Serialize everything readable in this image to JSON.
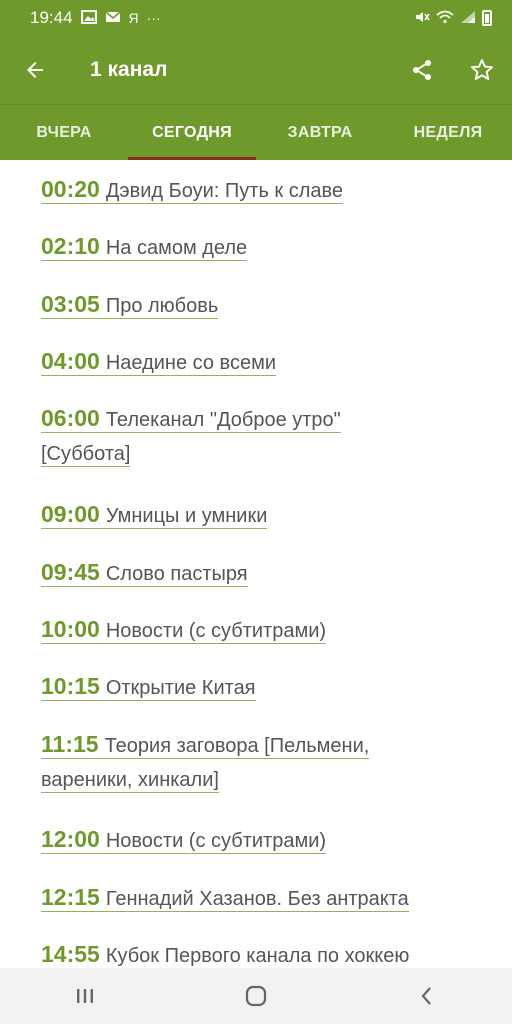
{
  "status": {
    "time": "19:44",
    "carrier_glyph": "Я",
    "more": "···"
  },
  "appbar": {
    "title": "1 канал"
  },
  "tabs": [
    "ВЧЕРА",
    "СЕГОДНЯ",
    "ЗАВТРА",
    "НЕДЕЛЯ"
  ],
  "active_tab": "СЕГОДНЯ",
  "schedule": [
    {
      "time": "00:20",
      "title": "Дэвид Боуи: Путь к славе"
    },
    {
      "time": "02:10",
      "title": "На самом деле"
    },
    {
      "time": "03:05",
      "title": "Про любовь"
    },
    {
      "time": "04:00",
      "title": "Наедине со всеми"
    },
    {
      "time": "06:00",
      "title": "Телеканал \"Доброе утро\" [Суббота]"
    },
    {
      "time": "09:00",
      "title": "Умницы и умники"
    },
    {
      "time": "09:45",
      "title": "Слово пастыря"
    },
    {
      "time": "10:00",
      "title": "Новости (с субтитрами)"
    },
    {
      "time": "10:15",
      "title": "Открытие Китая"
    },
    {
      "time": "11:15",
      "title": "Теория заговора [Пельмени, вареники, хинкали]"
    },
    {
      "time": "12:00",
      "title": "Новости (с субтитрами)"
    },
    {
      "time": "12:15",
      "title": "Геннадий Хазанов. Без антракта"
    },
    {
      "time": "14:55",
      "title": "Кубок Первого канала по хоккею"
    }
  ],
  "colors": {
    "primary": "#6e9a2b",
    "tab_indicator": "#8a2a1a",
    "time_text": "#6e9a2b",
    "title_text": "#555555"
  },
  "icons": {
    "back": "arrow-left-icon",
    "share": "share-icon",
    "favorite": "star-icon",
    "nav_recents": "recents-icon",
    "nav_home": "home-icon",
    "nav_back": "back-chevron-icon"
  }
}
